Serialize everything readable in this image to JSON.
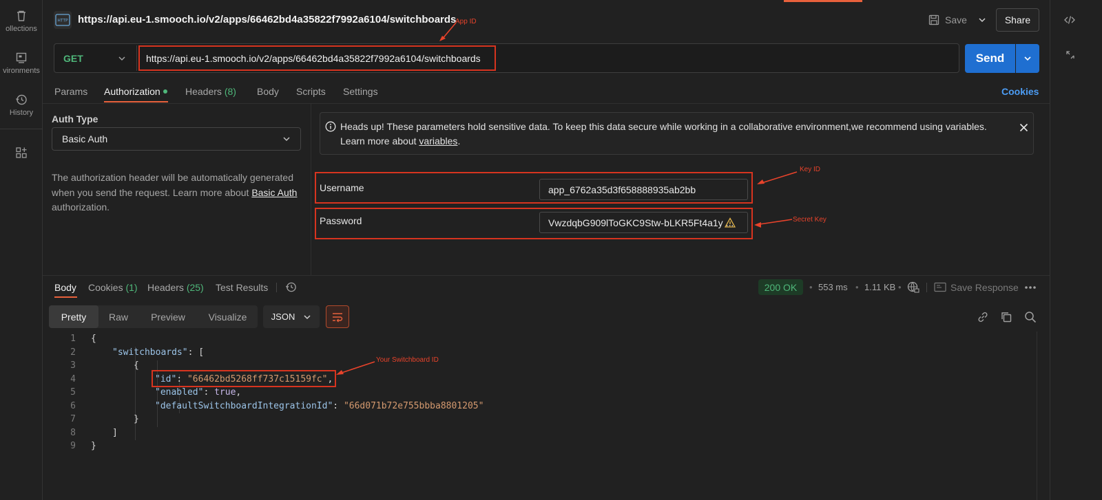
{
  "sidebar": {
    "items": [
      {
        "label": "ollections",
        "icon": "trash-icon"
      },
      {
        "label": "vironments",
        "icon": "environment-icon"
      },
      {
        "label": "History",
        "icon": "history-icon"
      },
      {
        "label": "",
        "icon": "grid-plus-icon"
      }
    ]
  },
  "header": {
    "title": "https://api.eu-1.smooch.io/v2/apps/66462bd4a35822f7992a6104/switchboards",
    "save_label": "Save",
    "share_label": "Share"
  },
  "request": {
    "method": "GET",
    "url": "https://api.eu-1.smooch.io/v2/apps/66462bd4a35822f7992a6104/switchboards",
    "send_label": "Send"
  },
  "request_tabs": {
    "params": "Params",
    "authorization": "Authorization",
    "headers": "Headers",
    "headers_count": "(8)",
    "body": "Body",
    "scripts": "Scripts",
    "settings": "Settings",
    "cookies": "Cookies"
  },
  "auth": {
    "type_label": "Auth Type",
    "type_value": "Basic Auth",
    "desc_before": "The authorization header will be automatically generated when you send the request. Learn more about ",
    "desc_link": "Basic Auth",
    "desc_after": " authorization.",
    "banner_before": "Heads up! These parameters hold sensitive data. To keep this data secure while working in a collaborative environment,we recommend using variables. Learn more about ",
    "banner_link": "variables",
    "banner_after": ".",
    "username_label": "Username",
    "username_value": "app_6762a35d3f658888935ab2bb",
    "password_label": "Password",
    "password_value": "VwzdqbG909lToGKC9Stw-bLKR5Ft4a1y ..."
  },
  "annotations": {
    "app_id": "App ID",
    "key_id": "Key ID",
    "secret_key": "Secret Key",
    "switchboard_id": "Your Switchboard ID",
    "color": "#d8341f"
  },
  "response": {
    "tabs": {
      "body": "Body",
      "cookies": "Cookies",
      "cookies_count": "(1)",
      "headers": "Headers",
      "headers_count": "(25)",
      "test_results": "Test Results"
    },
    "status": "200 OK",
    "time": "553 ms",
    "size": "1.11 KB",
    "save_response": "Save Response",
    "view_modes": [
      "Pretty",
      "Raw",
      "Preview",
      "Visualize"
    ],
    "format": "JSON"
  },
  "code": {
    "line_numbers": [
      "1",
      "2",
      "3",
      "4",
      "5",
      "6",
      "7",
      "8",
      "9"
    ],
    "l1": "{",
    "l2_key": "\"switchboards\"",
    "l2_rest": ": [",
    "l3": "{",
    "l4_key": "\"id\"",
    "l4_colon": ": ",
    "l4_val": "\"66462bd5268ff737c15159fc\"",
    "l4_comma": ",",
    "l5_key": "\"enabled\"",
    "l5_colon": ": ",
    "l5_val": "true",
    "l5_comma": ",",
    "l6_key": "\"defaultSwitchboardIntegrationId\"",
    "l6_colon": ": ",
    "l6_val": "\"66d071b72e755bbba8801205\"",
    "l7": "}",
    "l8": "]",
    "l9": "}"
  }
}
